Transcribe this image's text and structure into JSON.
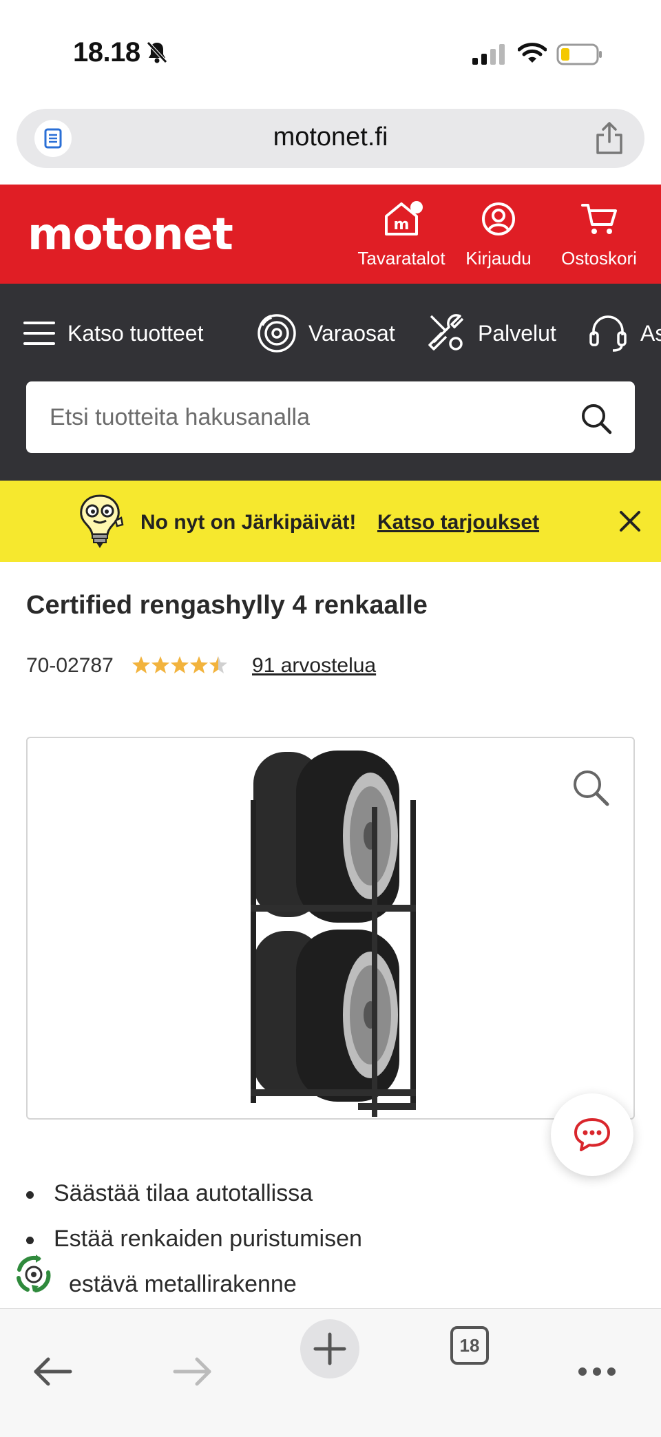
{
  "status_bar": {
    "time": "18.18"
  },
  "browser": {
    "url": "motonet.fi",
    "tabs_count": "18"
  },
  "header": {
    "logo": "motonet",
    "items": [
      {
        "label": "Tavaratalot",
        "icon": "store-icon"
      },
      {
        "label": "Kirjaudu",
        "icon": "user-icon"
      },
      {
        "label": "Ostoskori",
        "icon": "cart-icon"
      }
    ]
  },
  "nav": {
    "items": [
      {
        "label": "Katso tuotteet",
        "icon": "menu-icon"
      },
      {
        "label": "Varaosat",
        "icon": "brake-disc-icon"
      },
      {
        "label": "Palvelut",
        "icon": "tools-icon"
      },
      {
        "label": "As",
        "icon": "headset-icon"
      }
    ],
    "search_placeholder": "Etsi tuotteita hakusanalla"
  },
  "promo": {
    "text": "No nyt on Järkipäivät!",
    "link": "Katso tarjoukset"
  },
  "product": {
    "title": "Certified rengashylly 4 renkaalle",
    "sku": "70-02787",
    "rating": 4.5,
    "rating_max": 5,
    "reviews": "91 arvostelua",
    "features": [
      "Säästää tilaa autotallissa",
      "Estää renkaiden puristumisen",
      "estävä metallirakenne"
    ]
  },
  "colors": {
    "brand_red": "#e01e25",
    "nav_dark": "#323236",
    "promo_yellow": "#f6e82e",
    "star": "#f2b33d"
  }
}
